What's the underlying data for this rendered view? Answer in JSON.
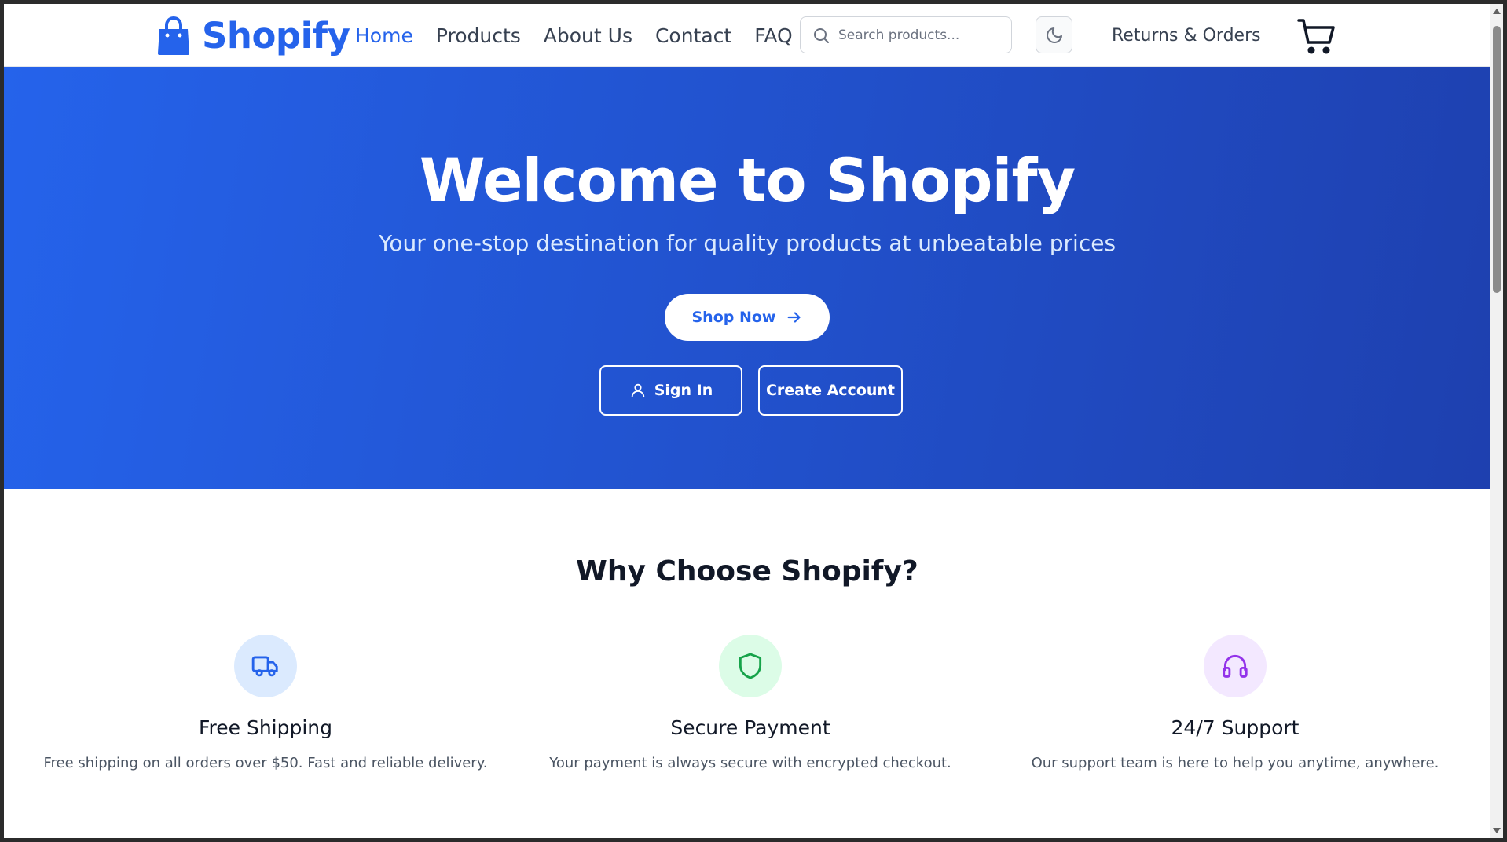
{
  "header": {
    "brand": "Shopify",
    "nav": [
      {
        "label": "Home",
        "active": true
      },
      {
        "label": "Products",
        "active": false
      },
      {
        "label": "About Us",
        "active": false
      },
      {
        "label": "Contact",
        "active": false
      },
      {
        "label": "FAQ",
        "active": false
      }
    ],
    "search_placeholder": "Search products...",
    "returns_label": "Returns & Orders",
    "icons": [
      "shopping-bag-icon",
      "search-icon",
      "moon-icon",
      "cart-icon"
    ]
  },
  "hero": {
    "title": "Welcome to Shopify",
    "subtitle": "Your one-stop destination for quality products at unbeatable prices",
    "shop_now_label": "Shop Now",
    "sign_in_label": "Sign In",
    "create_account_label": "Create Account"
  },
  "features": {
    "title": "Why Choose Shopify?",
    "items": [
      {
        "icon": "truck-icon",
        "title": "Free Shipping",
        "text": "Free shipping on all orders over $50. Fast and reliable delivery.",
        "color": "#2563eb",
        "bg": "#dbeafe"
      },
      {
        "icon": "shield-icon",
        "title": "Secure Payment",
        "text": "Your payment is always secure with encrypted checkout.",
        "color": "#16a34a",
        "bg": "#dcfce7"
      },
      {
        "icon": "headphones-icon",
        "title": "24/7 Support",
        "text": "Our support team is here to help you anytime, anywhere.",
        "color": "#9333ea",
        "bg": "#f3e8ff"
      }
    ]
  },
  "colors": {
    "brand": "#2563eb",
    "hero_start": "#2563eb",
    "hero_end": "#1e40af"
  }
}
